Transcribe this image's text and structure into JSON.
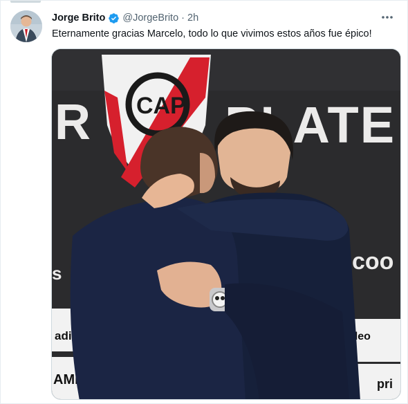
{
  "tweet": {
    "author_name": "Jorge Brito",
    "author_handle": "@JorgeBrito",
    "separator": "·",
    "timestamp": "2h",
    "text": "Eternamente gracias Marcelo, todo lo que vivimos estos años fue épico!",
    "verified": true
  },
  "media": {
    "backdrop_words": [
      "R",
      "PLATE",
      "coo",
      "CAP"
    ],
    "sponsor_labels": [
      "adidas",
      "ideo",
      "AMI",
      "pri",
      "s"
    ]
  },
  "colors": {
    "verified_blue": "#1d9bf0",
    "secondary_text": "#536471",
    "club_red": "#d6202d",
    "backdrop_dark": "#2b2b2d"
  }
}
